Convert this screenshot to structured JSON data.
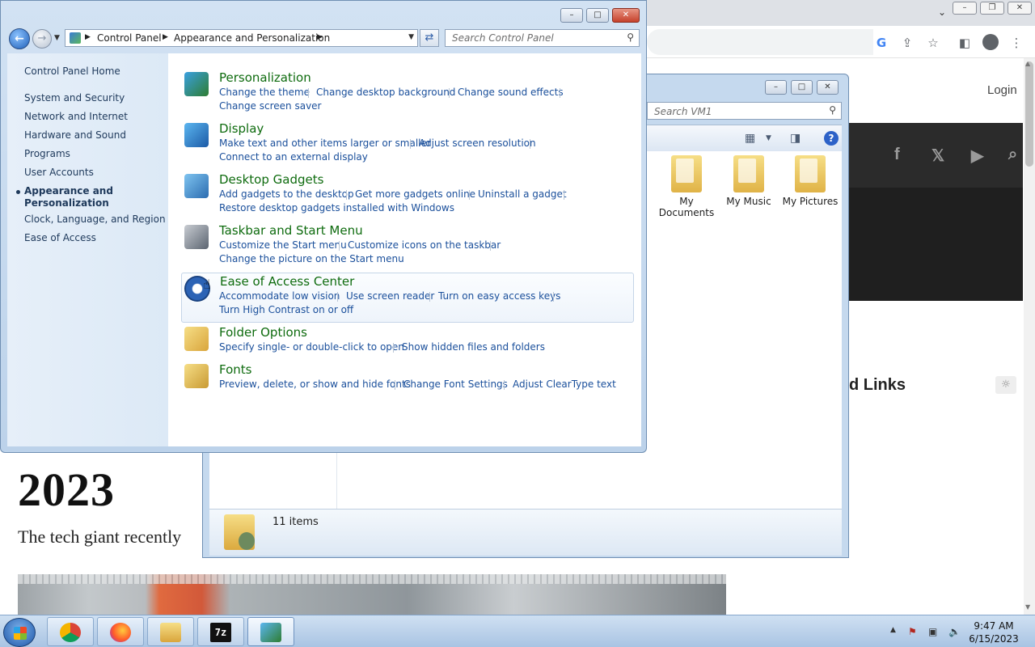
{
  "browser": {
    "login": "Login",
    "heading_links": "d Links",
    "year": "2023",
    "subtitle": "The tech giant recently",
    "social": [
      "f",
      "𝕏",
      "▶",
      "⌕"
    ]
  },
  "explorer": {
    "search_placeholder": "Search VM1",
    "folders": [
      {
        "label": "My Documents"
      },
      {
        "label": "My Music"
      },
      {
        "label": "My Pictures"
      }
    ],
    "status": "11 items"
  },
  "control_panel": {
    "breadcrumb": [
      "Control Panel",
      "Appearance and Personalization"
    ],
    "search_placeholder": "Search Control Panel",
    "left_nav": {
      "home": "Control Panel Home",
      "items": [
        "System and Security",
        "Network and Internet",
        "Hardware and Sound",
        "Programs",
        "User Accounts",
        "Appearance and Personalization",
        "Clock, Language, and Region",
        "Ease of Access"
      ],
      "current_index": 5
    },
    "categories": [
      {
        "title": "Personalization",
        "icon": "personalization-icon",
        "tasks": [
          "Change the theme",
          "Change desktop background",
          "Change sound effects",
          "Change screen saver"
        ]
      },
      {
        "title": "Display",
        "icon": "display-icon",
        "tasks": [
          "Make text and other items larger or smaller",
          "Adjust screen resolution",
          "Connect to an external display"
        ]
      },
      {
        "title": "Desktop Gadgets",
        "icon": "gadgets-icon",
        "tasks": [
          "Add gadgets to the desktop",
          "Get more gadgets online",
          "Uninstall a gadget",
          "Restore desktop gadgets installed with Windows"
        ]
      },
      {
        "title": "Taskbar and Start Menu",
        "icon": "taskbar-icon",
        "tasks": [
          "Customize the Start menu",
          "Customize icons on the taskbar",
          "Change the picture on the Start menu"
        ]
      },
      {
        "title": "Ease of Access Center",
        "icon": "ease-of-access-icon",
        "tasks": [
          "Accommodate low vision",
          "Use screen reader",
          "Turn on easy access keys",
          "Turn High Contrast on or off"
        ]
      },
      {
        "title": "Folder Options",
        "icon": "folder-options-icon",
        "tasks": [
          "Specify single- or double-click to open",
          "Show hidden files and folders"
        ]
      },
      {
        "title": "Fonts",
        "icon": "fonts-icon",
        "tasks": [
          "Preview, delete, or show and hide fonts",
          "Change Font Settings",
          "Adjust ClearType text"
        ]
      }
    ]
  },
  "taskbar": {
    "apps": [
      "chrome-icon",
      "firefox-icon",
      "file-explorer-icon",
      "7zip-icon",
      "control-panel-icon"
    ],
    "seven_zip_label": "7z",
    "time": "9:47 AM",
    "date": "6/15/2023"
  },
  "colors": {
    "category_title": "#0e6b0e",
    "task_link": "#1a4f9b",
    "left_nav_link": "#1e395b"
  }
}
